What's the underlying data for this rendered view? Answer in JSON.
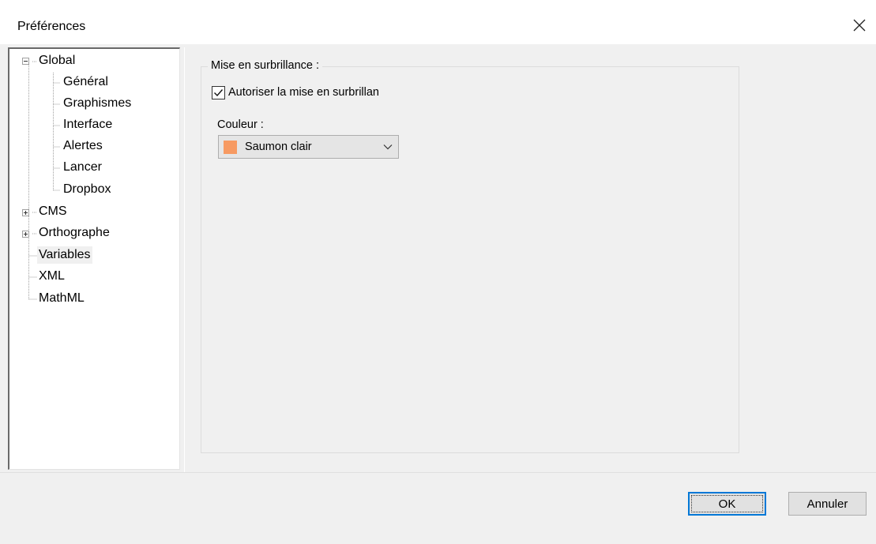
{
  "window": {
    "title": "Préférences",
    "close_icon": "close-icon"
  },
  "tree": {
    "items": [
      {
        "label": "Global",
        "expander": "minus"
      },
      {
        "label": "Général"
      },
      {
        "label": "Graphismes"
      },
      {
        "label": "Interface"
      },
      {
        "label": "Alertes"
      },
      {
        "label": "Lancer"
      },
      {
        "label": "Dropbox"
      },
      {
        "label": "CMS",
        "expander": "plus"
      },
      {
        "label": "Orthographe",
        "expander": "plus"
      },
      {
        "label": "Variables",
        "selected": true
      },
      {
        "label": "XML"
      },
      {
        "label": "MathML"
      }
    ]
  },
  "highlight": {
    "group_title": "Mise en surbrillance :",
    "checkbox_label": "Autoriser la mise en surbrillan",
    "checkbox_checked": true,
    "color_label": "Couleur :",
    "color_value": "Saumon clair",
    "color_swatch": "#f79a62"
  },
  "buttons": {
    "ok": "OK",
    "cancel": "Annuler"
  }
}
